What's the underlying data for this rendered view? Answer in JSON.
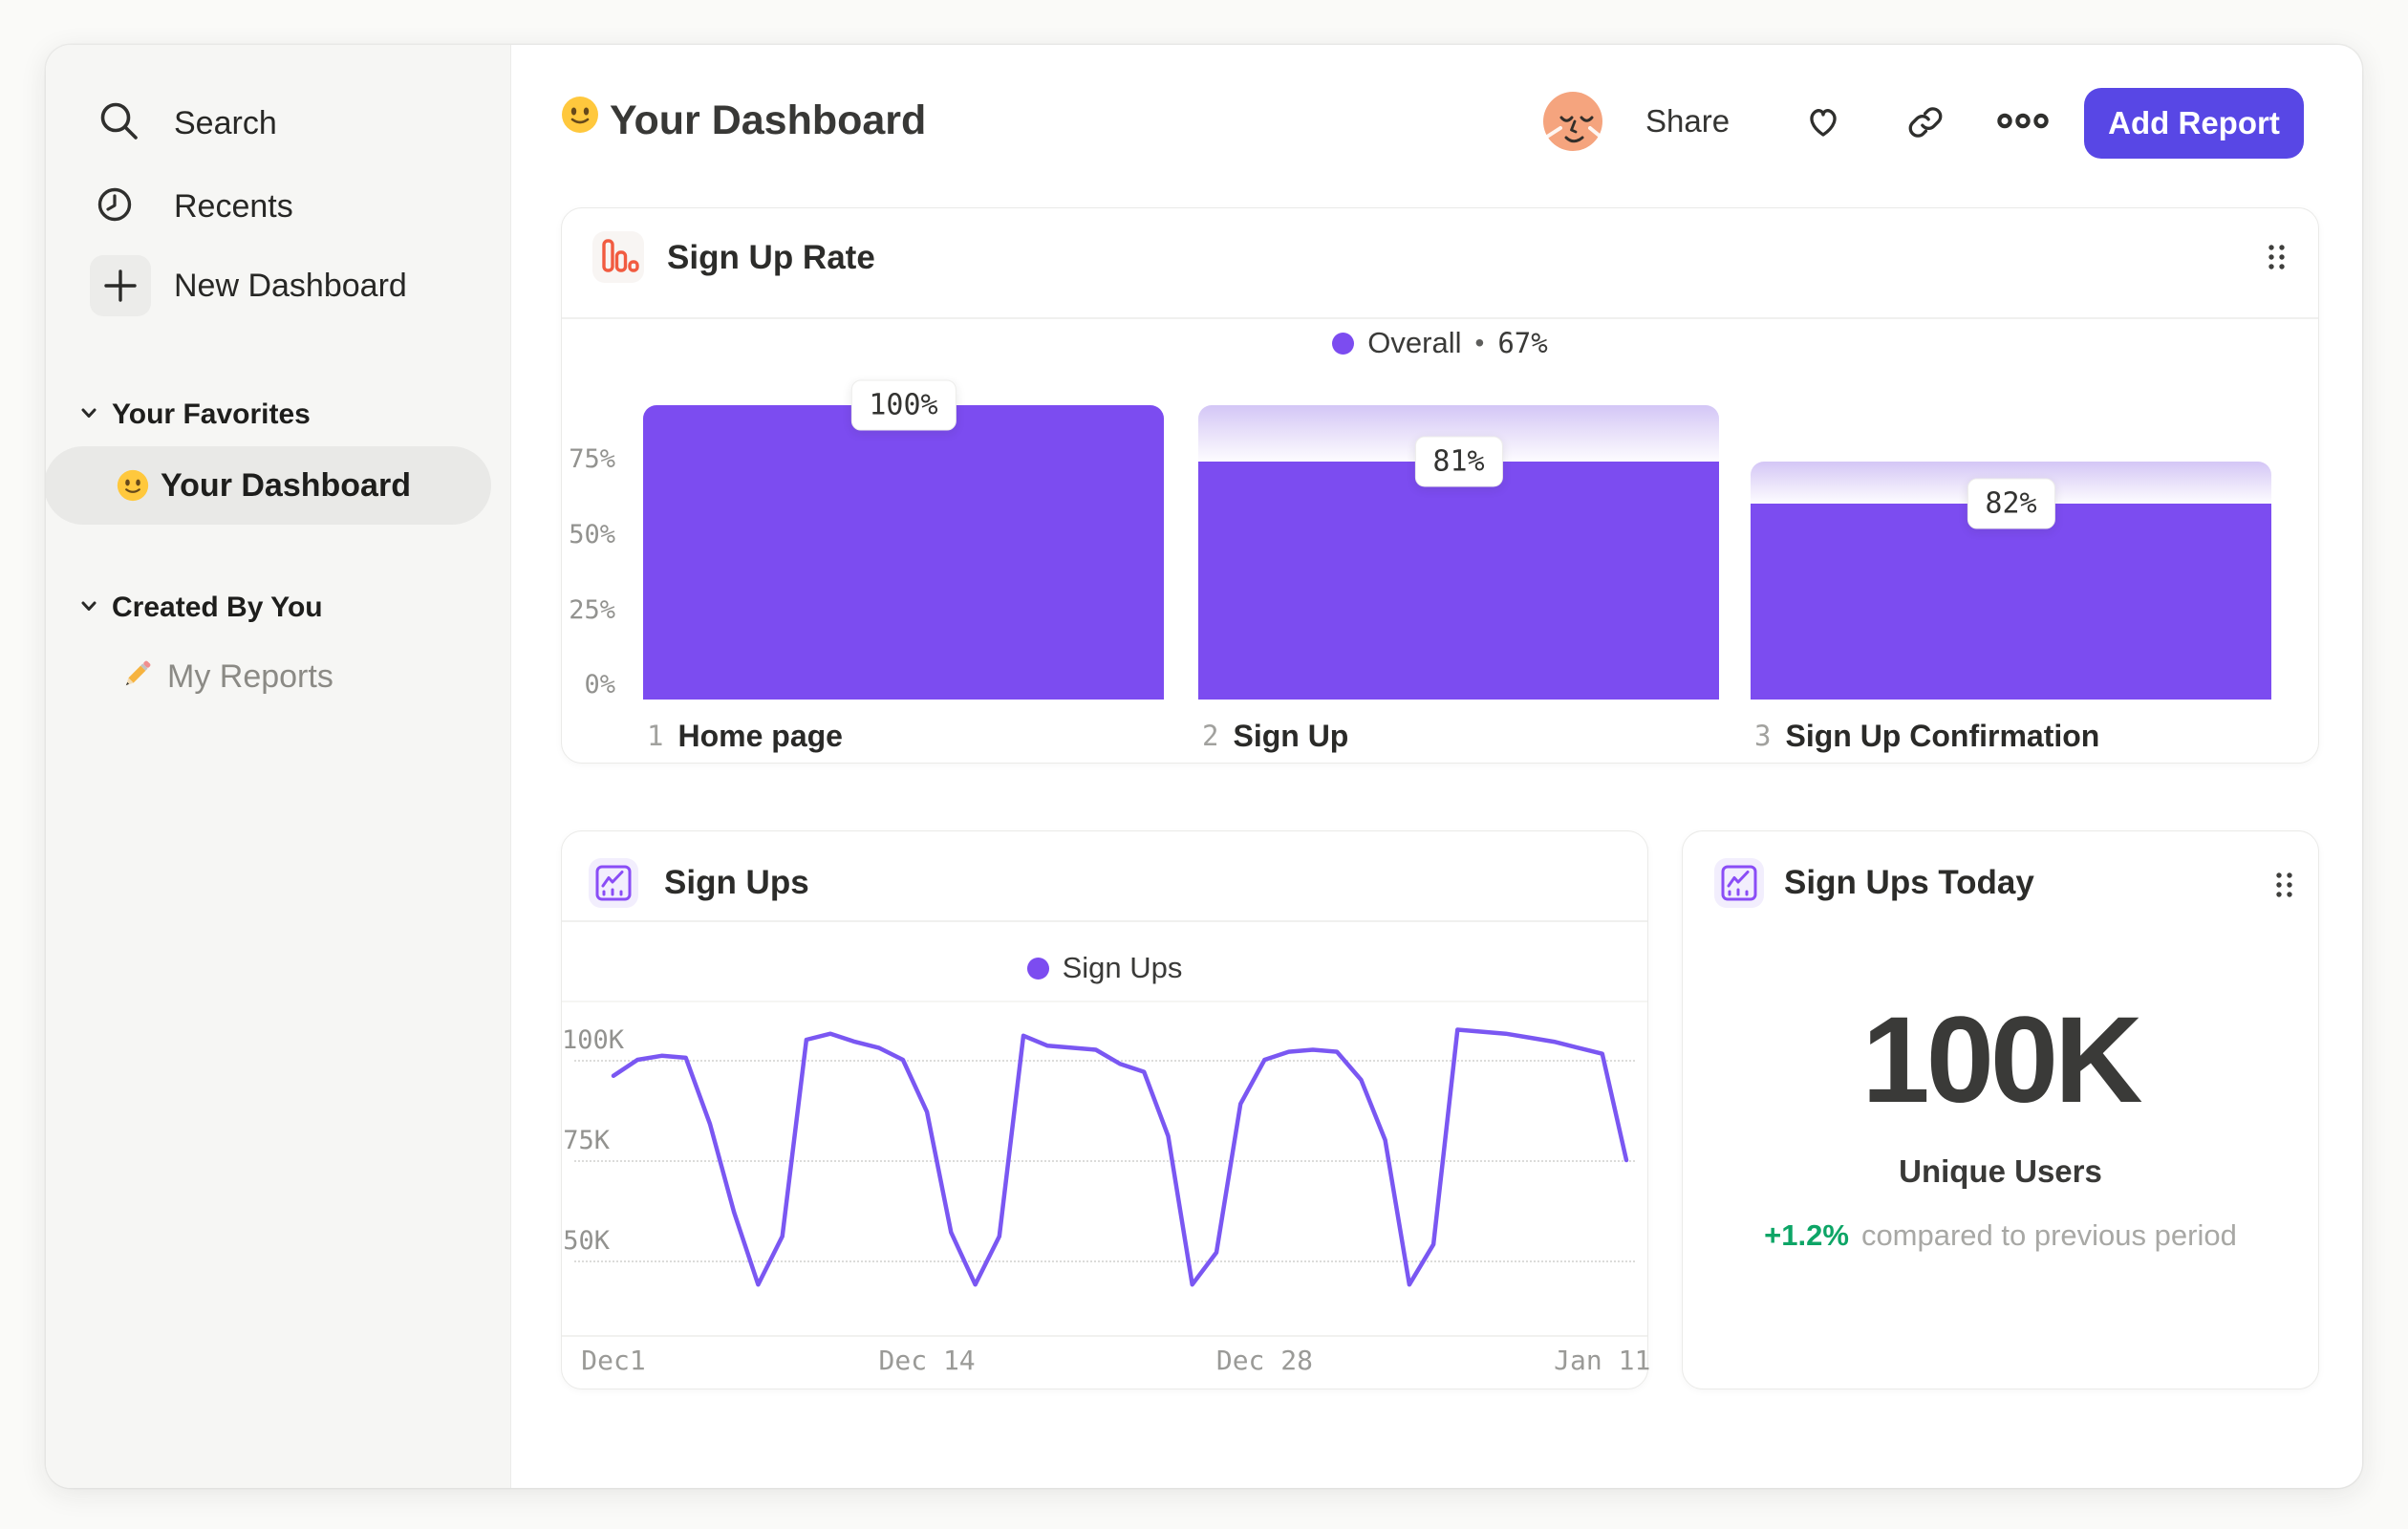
{
  "colors": {
    "accent_purple": "#7C4CF0",
    "line_purple": "#7A57F2",
    "button_purple": "#5847E5",
    "icon_orange": "#F15B40",
    "icon_purple": "#8A4DF6",
    "positive_green": "#0DA566",
    "selected_pill_gray": "#E9E9E7"
  },
  "sidebar": {
    "nav": [
      {
        "label": "Search",
        "icon": "search-icon"
      },
      {
        "label": "Recents",
        "icon": "clock-icon"
      },
      {
        "label": "New Dashboard",
        "icon": "plus-icon"
      }
    ],
    "sections": [
      {
        "header": "Your Favorites",
        "items": [
          {
            "label": "Your Dashboard",
            "icon": "smiley-emoji",
            "selected": true
          }
        ]
      },
      {
        "header": "Created By You",
        "items": [
          {
            "label": "My Reports",
            "icon": "pencil-emoji",
            "selected": false
          }
        ]
      }
    ]
  },
  "header": {
    "emoji": "slightly-smiling-face",
    "title": "Your Dashboard",
    "share_label": "Share",
    "add_report_label": "Add Report"
  },
  "funnel_card": {
    "title": "Sign Up Rate",
    "legend": {
      "label": "Overall",
      "separator": "•",
      "value": "67%"
    },
    "y_ticks": [
      "75%",
      "50%",
      "25%",
      "0%"
    ]
  },
  "line_card": {
    "title": "Sign Ups",
    "legend": {
      "label": "Sign Ups"
    }
  },
  "metric_card": {
    "title": "Sign Ups Today",
    "value": "100K",
    "label": "Unique Users",
    "delta": "+1.2%",
    "delta_note": "compared to previous period"
  },
  "chart_data": [
    {
      "type": "bar",
      "subtype": "funnel",
      "title": "Sign Up Rate",
      "overall_conversion_pct": 67,
      "ylim": [
        0,
        100
      ],
      "y_ticks_pct": [
        75,
        50,
        25,
        0
      ],
      "legend": "Overall • 67%",
      "steps": [
        {
          "num": "1",
          "name": "Home page",
          "label": "100%",
          "step_conversion_pct": 100,
          "overall_pct": 100,
          "prev_pct": 100
        },
        {
          "num": "2",
          "name": "Sign Up",
          "label": "81%",
          "step_conversion_pct": 81,
          "overall_pct": 81,
          "prev_pct": 100
        },
        {
          "num": "3",
          "name": "Sign Up Confirmation",
          "label": "82%",
          "step_conversion_pct": 82,
          "overall_pct": 66.4,
          "prev_pct": 81
        }
      ]
    },
    {
      "type": "line",
      "title": "Sign Ups",
      "legend": "Sign Ups",
      "x_start": "Dec 1",
      "x_end": "Jan 12",
      "x_unit": "day",
      "x_tick_labels": [
        "Dec1",
        "Dec 14",
        "Dec 28",
        "Jan 11"
      ],
      "x_tick_indices": [
        0,
        13,
        27,
        41
      ],
      "y_tick_labels": [
        "100K",
        "75K",
        "50K"
      ],
      "y_tick_values": [
        100000,
        75000,
        50000
      ],
      "ylim": [
        38000,
        112000
      ],
      "grid": "dashed-horizontal",
      "legend_position": "top-center",
      "values": [
        96000,
        100000,
        101000,
        100500,
        84000,
        62000,
        44000,
        56000,
        105000,
        106500,
        104500,
        103000,
        100000,
        87000,
        57000,
        44000,
        56000,
        106000,
        103500,
        103000,
        102500,
        99000,
        97000,
        81000,
        44000,
        52000,
        89000,
        100000,
        102000,
        102500,
        102000,
        95000,
        80000,
        44000,
        54000,
        107500,
        107000,
        106500,
        105500,
        104500,
        103000,
        101500,
        75000
      ]
    },
    {
      "type": "metric",
      "title": "Sign Ups Today",
      "value": "100K",
      "label": "Unique Users",
      "delta_pct": 1.2,
      "delta_direction": "up",
      "note": "compared to previous period"
    }
  ]
}
